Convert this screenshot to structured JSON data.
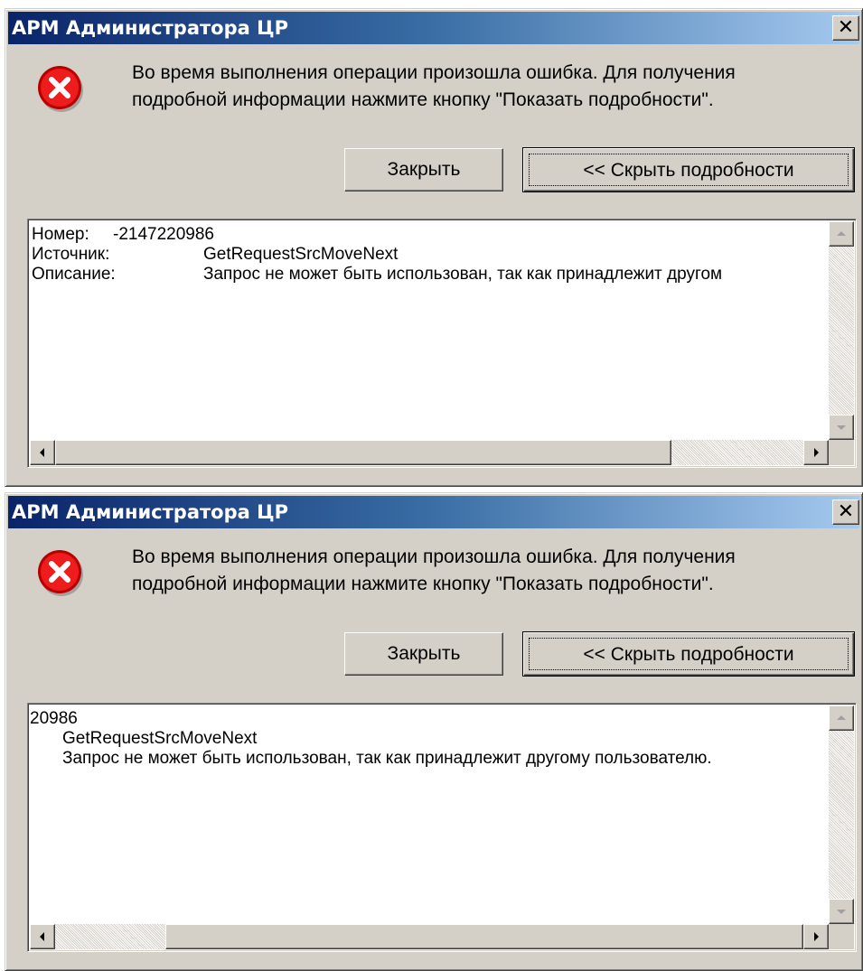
{
  "dialogs": [
    {
      "title": "АРМ Администратора ЦР",
      "close_glyph": "✕",
      "icon": "error-icon",
      "message_line1": "Во время выполнения операции произошла ошибка. Для получения",
      "message_line2": "подробной информации нажмите кнопку \"Показать подробности\".",
      "button_close": "Закрыть",
      "button_details": "<< Скрыть подробности",
      "details": {
        "number_label": "Номер:",
        "number_value": "-2147220986",
        "source_label": "Источник:",
        "source_value": "GetRequestSrcMoveNext",
        "desc_label": "Описание:",
        "desc_value": "Запрос не может быть использован, так как принадлежит другом"
      }
    },
    {
      "title": "АРМ Администратора ЦР",
      "close_glyph": "✕",
      "icon": "error-icon",
      "message_line1": "Во время выполнения операции произошла ошибка. Для получения",
      "message_line2": "подробной информации нажмите кнопку \"Показать подробности\".",
      "button_close": "Закрыть",
      "button_details": "<< Скрыть подробности",
      "details": {
        "number_value": "20986",
        "source_value": "GetRequestSrcMoveNext",
        "desc_value": "Запрос не может быть использован, так как принадлежит другому пользователю."
      }
    }
  ]
}
